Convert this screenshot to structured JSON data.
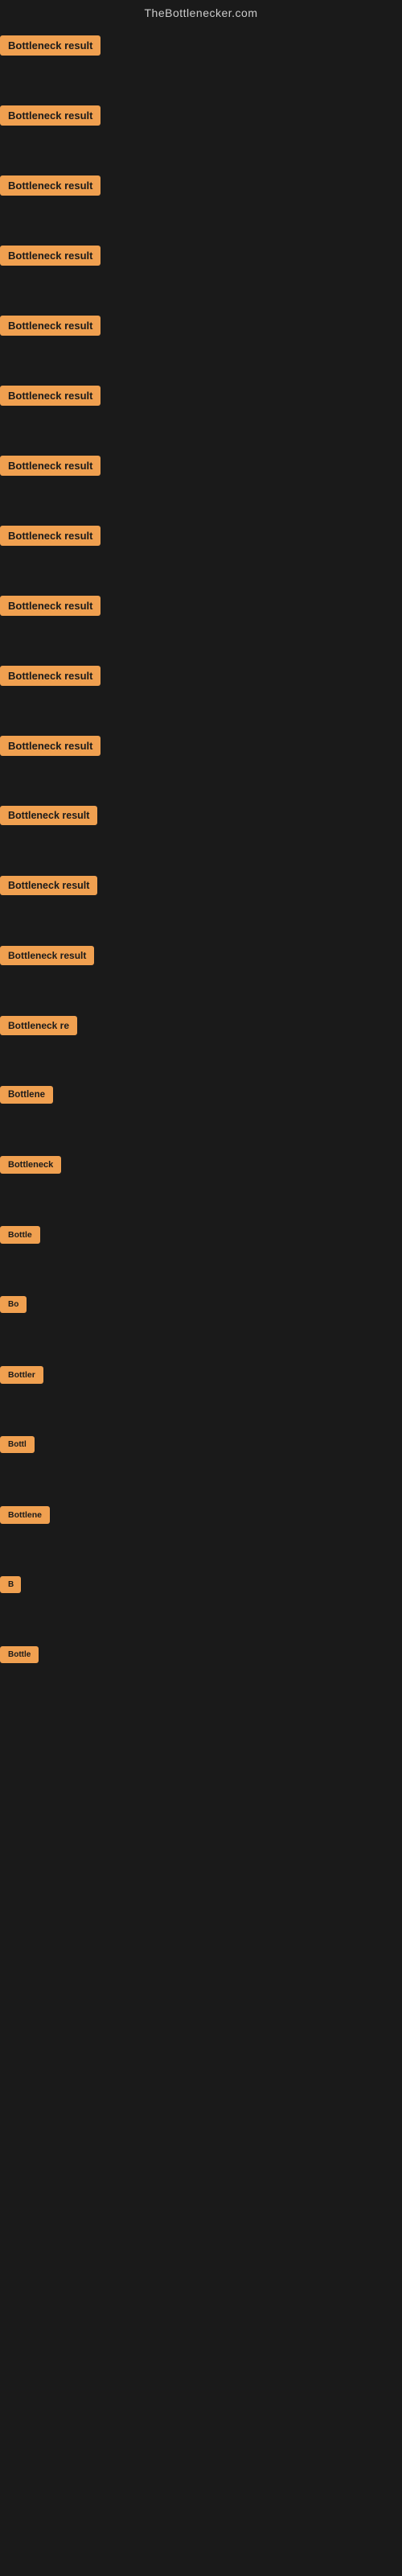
{
  "site": {
    "title": "TheBottlenecker.com"
  },
  "items": [
    {
      "id": 1,
      "label": "Bottleneck result"
    },
    {
      "id": 2,
      "label": "Bottleneck result"
    },
    {
      "id": 3,
      "label": "Bottleneck result"
    },
    {
      "id": 4,
      "label": "Bottleneck result"
    },
    {
      "id": 5,
      "label": "Bottleneck result"
    },
    {
      "id": 6,
      "label": "Bottleneck result"
    },
    {
      "id": 7,
      "label": "Bottleneck result"
    },
    {
      "id": 8,
      "label": "Bottleneck result"
    },
    {
      "id": 9,
      "label": "Bottleneck result"
    },
    {
      "id": 10,
      "label": "Bottleneck result"
    },
    {
      "id": 11,
      "label": "Bottleneck result"
    },
    {
      "id": 12,
      "label": "Bottleneck result"
    },
    {
      "id": 13,
      "label": "Bottleneck result"
    },
    {
      "id": 14,
      "label": "Bottleneck result"
    },
    {
      "id": 15,
      "label": "Bottleneck re"
    },
    {
      "id": 16,
      "label": "Bottlene"
    },
    {
      "id": 17,
      "label": "Bottleneck"
    },
    {
      "id": 18,
      "label": "Bottle"
    },
    {
      "id": 19,
      "label": "Bo"
    },
    {
      "id": 20,
      "label": "Bottler"
    },
    {
      "id": 21,
      "label": "Bottl"
    },
    {
      "id": 22,
      "label": "Bottlene"
    },
    {
      "id": 23,
      "label": "B"
    },
    {
      "id": 24,
      "label": "Bottle"
    }
  ]
}
